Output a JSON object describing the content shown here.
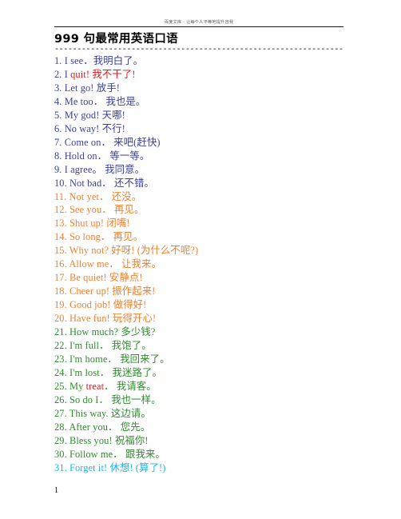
{
  "header": {
    "watermark": "百度文库 - 让每个人平等地提升自我"
  },
  "title": "999 句最常用英语口语",
  "divider": "-------------------------------------------------------------------------",
  "colors": {
    "navy": "#3b3f9e",
    "orange": "#f08030",
    "green": "#2e8b2e",
    "cyan": "#18b6e8",
    "red": "#e8161a",
    "black": "#000000",
    "watermark": "#5a5a5a"
  },
  "phrases": [
    {
      "num": "1.",
      "en": "I see．",
      "cn": "我明白了。",
      "color": "navy"
    },
    {
      "num": "2.",
      "en": "I ",
      "en_hl": "quit!",
      "cn": " 我不干了!",
      "color": "navy",
      "cn_color": "red"
    },
    {
      "num": "3.",
      "en": "Let go!",
      "cn": " 放手!",
      "color": "navy"
    },
    {
      "num": "4.",
      "en": "Me too．",
      "cn": "  我也是。",
      "color": "navy"
    },
    {
      "num": "5.",
      "en": "My god!",
      "cn": " 天哪!",
      "color": "navy"
    },
    {
      "num": "6.",
      "en": "No way!",
      "cn": " 不行!",
      "color": "navy"
    },
    {
      "num": "7.",
      "en": "Come on．",
      "cn": "  来吧(赶快)",
      "color": "navy"
    },
    {
      "num": "8.",
      "en": "Hold on．",
      "cn": "  等一等。",
      "color": "navy"
    },
    {
      "num": "9.",
      "en": "I agree。",
      "cn": " 我同意。",
      "color": "navy"
    },
    {
      "num": "10.",
      "en": "Not bad．",
      "cn": "  还不错。",
      "color": "navy"
    },
    {
      "num": "11.",
      "en": "Not yet．",
      "cn": "  还没。",
      "color": "orange"
    },
    {
      "num": "12.",
      "en": "See you．",
      "cn": "  再见。",
      "color": "orange"
    },
    {
      "num": "13.",
      "en": "Shut up!",
      "cn": " 闭嘴!",
      "color": "orange"
    },
    {
      "num": "14.",
      "en": "So long．",
      "cn": "  再见。",
      "color": "orange"
    },
    {
      "num": "15.",
      "en": "Why not?",
      "cn": " 好呀! (为什么不呢?)",
      "color": "orange"
    },
    {
      "num": "16.",
      "en": "Allow me．",
      "cn": "  让我来。",
      "color": "orange"
    },
    {
      "num": "17.",
      "en": "Be quiet!",
      "cn": " 安静点!",
      "color": "orange"
    },
    {
      "num": "18.",
      "en": "Cheer up!",
      "cn": " 振作起来!",
      "color": "orange"
    },
    {
      "num": "19.",
      "en": "Good job!",
      "cn": " 做得好!",
      "color": "orange"
    },
    {
      "num": "20.",
      "en": "Have fun!",
      "cn": " 玩得开心!",
      "color": "orange"
    },
    {
      "num": "21.",
      "en": "How much?",
      "cn": " 多少钱?",
      "color": "green"
    },
    {
      "num": "22.",
      "en": "I'm full．",
      "cn": "  我饱了。",
      "color": "green"
    },
    {
      "num": "23.",
      "en": "I'm home．",
      "cn": "  我回来了。",
      "color": "green"
    },
    {
      "num": "24.",
      "en": "I'm lost．",
      "cn": "  我迷路了。",
      "color": "green"
    },
    {
      "num": "25.",
      "en": "My ",
      "en_hl": "treat",
      "cn": "．  我请客。",
      "color": "green"
    },
    {
      "num": "26.",
      "en": "So do I．",
      "cn": "  我也一样。",
      "color": "green"
    },
    {
      "num": "27.",
      "en": "This way.",
      "cn": " 这边请。",
      "color": "green"
    },
    {
      "num": "28.",
      "en": "After you．",
      "cn": "  您先。",
      "color": "green"
    },
    {
      "num": "29.",
      "en": "Bless you!",
      "cn": " 祝福你!",
      "color": "green"
    },
    {
      "num": "30.",
      "en": "Follow me．",
      "cn": "  跟我来。",
      "color": "green"
    },
    {
      "num": "31.",
      "en": "Forget it!",
      "cn": " 休想! (算了!)",
      "color": "cyan"
    }
  ],
  "footer": {
    "page_number": "1"
  }
}
